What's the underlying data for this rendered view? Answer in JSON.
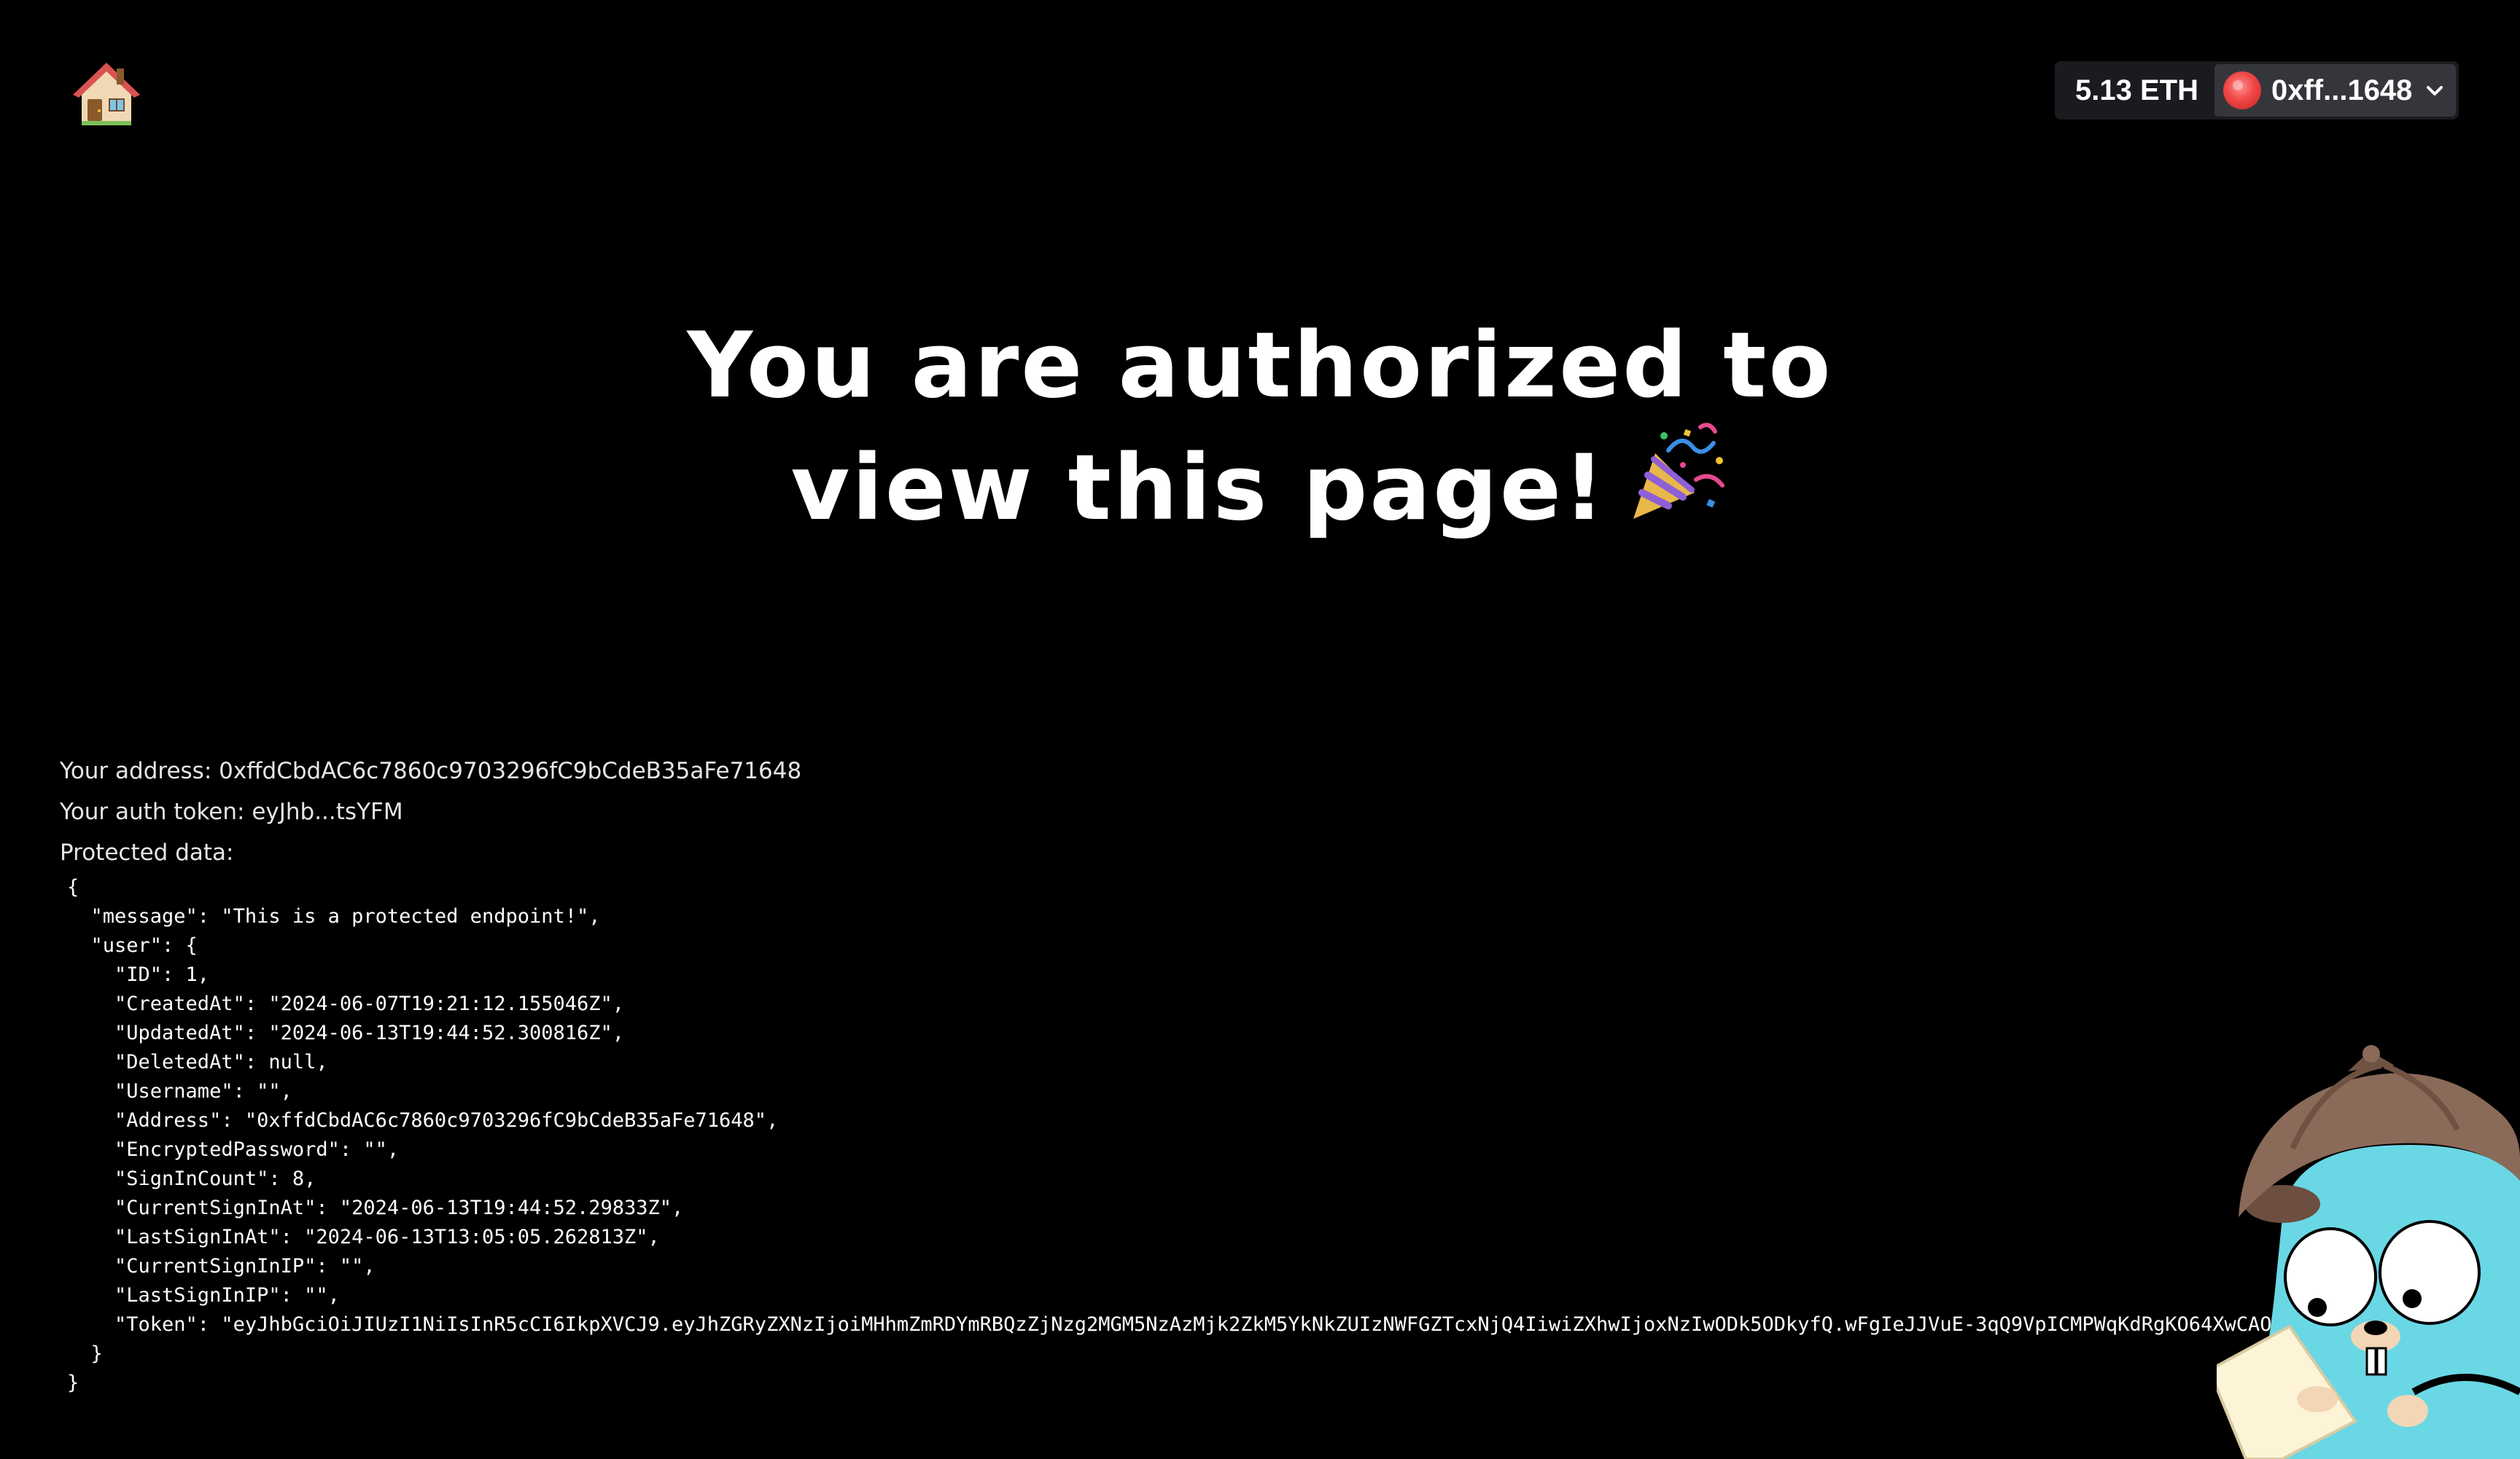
{
  "header": {
    "home_icon": "house-emoji-icon",
    "wallet": {
      "balance": "5.13 ETH",
      "account": "0xff...1648",
      "avatar_color": "#f04646",
      "dropdown_icon": "chevron-down-icon"
    }
  },
  "hero": {
    "line1": "You are authorized to",
    "line2": "view this page!",
    "emoji_icon": "party-popper-icon"
  },
  "info": {
    "address_label": "Your address: 0xffdCbdAC6c7860c9703296fC9bCdeB35aFe71648",
    "token_label": "Your auth token: eyJhb...tsYFM",
    "protected_label": "Protected data:"
  },
  "protected_json": "{\n  \"message\": \"This is a protected endpoint!\",\n  \"user\": {\n    \"ID\": 1,\n    \"CreatedAt\": \"2024-06-07T19:21:12.155046Z\",\n    \"UpdatedAt\": \"2024-06-13T19:44:52.300816Z\",\n    \"DeletedAt\": null,\n    \"Username\": \"\",\n    \"Address\": \"0xffdCbdAC6c7860c9703296fC9bCdeB35aFe71648\",\n    \"EncryptedPassword\": \"\",\n    \"SignInCount\": 8,\n    \"CurrentSignInAt\": \"2024-06-13T19:44:52.29833Z\",\n    \"LastSignInAt\": \"2024-06-13T13:05:05.262813Z\",\n    \"CurrentSignInIP\": \"\",\n    \"LastSignInIP\": \"\",\n    \"Token\": \"eyJhbGciOiJIUzI1NiIsInR5cCI6IkpXVCJ9.eyJhZGRyZXNzIjoiMHhmZmRDYmRBQzZjNzg2MGM5NzAzMjk2ZkM5YkNkZUIzNWFGZTcxNjQ4IiwiZXhwIjoxNzIwODk5ODkyfQ.wFgIeJJVuE-3qQ9VpICMPWqKdRgKO64XwCAOGttsYFM\"\n  }\n}",
  "decor": {
    "mascot_icon": "gopher-detective-icon"
  }
}
